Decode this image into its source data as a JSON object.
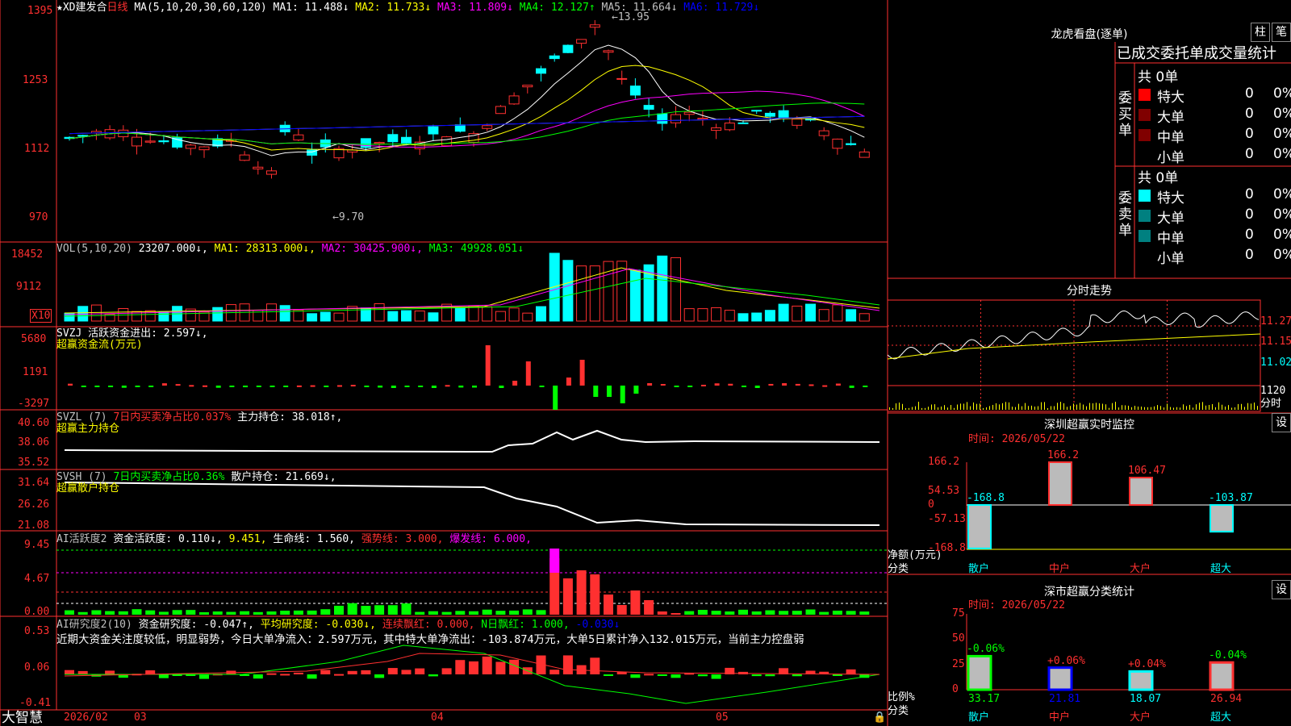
{
  "stock": {
    "name": "★XD建发合",
    "period": "日线",
    "ma_params": "MA(5,10,20,30,60,120)"
  },
  "ma_legend": [
    {
      "label": "MA1: 11.488",
      "arrow": "↓",
      "color": "#ffffff"
    },
    {
      "label": "MA2: 11.733",
      "arrow": "↓",
      "color": "#ffff00"
    },
    {
      "label": "MA3: 11.809",
      "arrow": "↓",
      "color": "#ff00ff"
    },
    {
      "label": "MA4: 12.127",
      "arrow": "↑",
      "color": "#00ff00"
    },
    {
      "label": "MA5: 11.664",
      "arrow": "↓",
      "color": "#c0c0c0"
    },
    {
      "label": "MA6: 11.729",
      "arrow": "↓",
      "color": "#0000ff"
    }
  ],
  "price_axis": [
    "1395",
    "1253",
    "1112",
    "970"
  ],
  "price_max_label": "13.95",
  "price_min_label": "9.70",
  "vol": {
    "legend": [
      {
        "label": "VOL(5,10,20)",
        "color": "#c0c0c0"
      },
      {
        "label": "23207.000↓,",
        "color": "#ffffff"
      },
      {
        "label": "MA1: 28313.000↓,",
        "color": "#ffff00"
      },
      {
        "label": "MA2: 30425.900↓,",
        "color": "#ff00ff"
      },
      {
        "label": "MA3: 49928.051↓",
        "color": "#00ff00"
      }
    ],
    "axis": [
      "18452",
      "9112"
    ],
    "unit": "X10"
  },
  "svzj": {
    "legend1": "SVZJ  活跃资金进出: 2.597↓,",
    "legend2": "超赢资金流(万元)",
    "axis": [
      "5680",
      "1191",
      "-3297"
    ]
  },
  "svzl": {
    "legend_a": "SVZL (7)",
    "legend_b": "7日内买卖净占比0.037%",
    "legend_c": "主力持仓: 38.018↑,",
    "legend2": "超赢主力持仓",
    "axis": [
      "40.60",
      "38.06",
      "35.52"
    ]
  },
  "svsh": {
    "legend_a": "SVSH (7)",
    "legend_b": "7日内买卖净占比0.36%",
    "legend_c": "散户持仓: 21.669↓,",
    "legend2": "超赢散户持仓",
    "axis": [
      "31.64",
      "26.26",
      "21.08"
    ]
  },
  "ai1": {
    "legend": [
      {
        "label": "AI活跃度2",
        "color": "#c0c0c0"
      },
      {
        "label": "资金活跃度: 0.110↓,",
        "color": "#ffffff"
      },
      {
        "label": "9.451,",
        "color": "#ffff00"
      },
      {
        "label": "生命线: 1.560,",
        "color": "#ffffff"
      },
      {
        "label": "强势线: 3.000,",
        "color": "#ff3030"
      },
      {
        "label": "爆发线: 6.000,",
        "color": "#ff00ff"
      }
    ],
    "axis": [
      "9.45",
      "4.67",
      "0.00"
    ]
  },
  "ai2": {
    "legend": [
      {
        "label": "AI研究度2(10)",
        "color": "#c0c0c0"
      },
      {
        "label": "资金研究度: -0.047↑,",
        "color": "#ffffff"
      },
      {
        "label": "平均研究度: -0.030↓,",
        "color": "#ffff00"
      },
      {
        "label": "连续飘红: 0.000,",
        "color": "#ff3030"
      },
      {
        "label": "N日飘红: 1.000,",
        "color": "#00ff00"
      },
      {
        "label": "-0.030↓",
        "color": "#0000ff"
      }
    ],
    "comment": "近期大资金关注度较低，明显弱势，今日大单净流入：2.597万元，其中特大单净流出：-103.874万元，大单5日累计净入132.015万元，当前主力控盘弱",
    "axis": [
      "0.53",
      "0.06",
      "-0.41"
    ]
  },
  "bottom_bar": {
    "brand": "大智慧",
    "dates": [
      "2026/02",
      "03",
      "04",
      "05"
    ]
  },
  "lhb": {
    "title": "龙虎看盘(逐单)",
    "btn1": "柱",
    "btn2": "笔",
    "subtitle": "已成交委托单成交量统计",
    "buy": {
      "side": [
        "委",
        "买",
        "单"
      ],
      "total": "共 0单",
      "rows": [
        {
          "name": "特大",
          "v": "0",
          "p": "0%",
          "color": "#ff0000"
        },
        {
          "name": "大单",
          "v": "0",
          "p": "0%",
          "color": "#800000"
        },
        {
          "name": "中单",
          "v": "0",
          "p": "0%",
          "color": "#800000"
        },
        {
          "name": "小单",
          "v": "0",
          "p": "0%",
          "color": ""
        }
      ]
    },
    "sell": {
      "side": [
        "委",
        "卖",
        "单"
      ],
      "total": "共 0单",
      "rows": [
        {
          "name": "特大",
          "v": "0",
          "p": "0%",
          "color": "#00ffff"
        },
        {
          "name": "大单",
          "v": "0",
          "p": "0%",
          "color": "#008080"
        },
        {
          "name": "中单",
          "v": "0",
          "p": "0%",
          "color": "#008080"
        },
        {
          "name": "小单",
          "v": "0",
          "p": "0%",
          "color": ""
        }
      ]
    }
  },
  "fenshi": {
    "title": "分时走势",
    "axis": [
      "11.27",
      "11.15",
      "11.02"
    ],
    "vol_label": "1120",
    "vol_unit": "分时"
  },
  "monitor": {
    "title": "深圳超赢实时监控",
    "btn": "设",
    "time": "时间: 2026/05/22",
    "axis": [
      "166.2",
      "54.53",
      "0",
      "-57.13",
      "-168.8"
    ],
    "ylabel1": "净额(万元)",
    "ylabel2": "分类",
    "categories": [
      "散户",
      "中户",
      "大户",
      "超大"
    ],
    "values": [
      -168.8,
      166.2,
      106.47,
      -103.87
    ],
    "value_labels": [
      "-168.8",
      "166.2",
      "106.47",
      "-103.87"
    ]
  },
  "stats": {
    "title": "深市超赢分类统计",
    "btn": "设",
    "time": "时间: 2026/05/22",
    "axis": [
      "75",
      "50",
      "25",
      "0"
    ],
    "ylabel1": "比例%",
    "ylabel2": "分类",
    "categories": [
      "散户",
      "中户",
      "大户",
      "超大"
    ],
    "values": [
      33.17,
      21.81,
      18.07,
      26.94
    ],
    "value_labels": [
      "33.17",
      "21.81",
      "18.07",
      "26.94"
    ],
    "change_labels": [
      "-0.06%",
      "+0.06%",
      "+0.04%",
      "-0.04%"
    ]
  }
}
